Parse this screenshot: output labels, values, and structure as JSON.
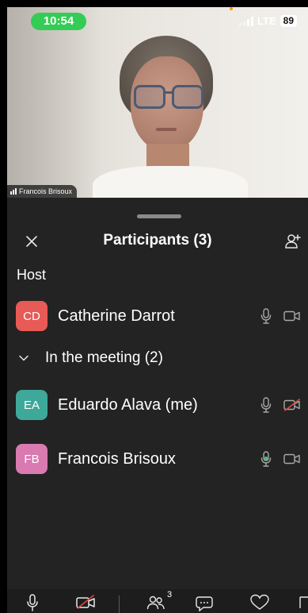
{
  "status_bar": {
    "time": "10:54",
    "network": "LTE",
    "battery": "89"
  },
  "video": {
    "participant_name": "Francois Brisoux"
  },
  "panel": {
    "title": "Participants (3)",
    "host_section": "Host",
    "meeting_group": "In the meeting (2)"
  },
  "participants": [
    {
      "initials": "CD",
      "name": "Catherine Darrot",
      "color": "#e85a55",
      "mic": "inactive",
      "camera": "on"
    },
    {
      "initials": "EA",
      "name": "Eduardo Alava (me)",
      "color": "#3ea89a",
      "mic": "inactive",
      "camera": "off"
    },
    {
      "initials": "FB",
      "name": "Francois Brisoux",
      "color": "#d97ab0",
      "mic": "active",
      "camera": "on"
    }
  ],
  "toolbar": {
    "participants_count": "3"
  },
  "colors": {
    "background": "#232323",
    "muted_red": "#e0473f",
    "speaking_green": "#35c46a",
    "icon_gray": "#a8a8a8"
  }
}
